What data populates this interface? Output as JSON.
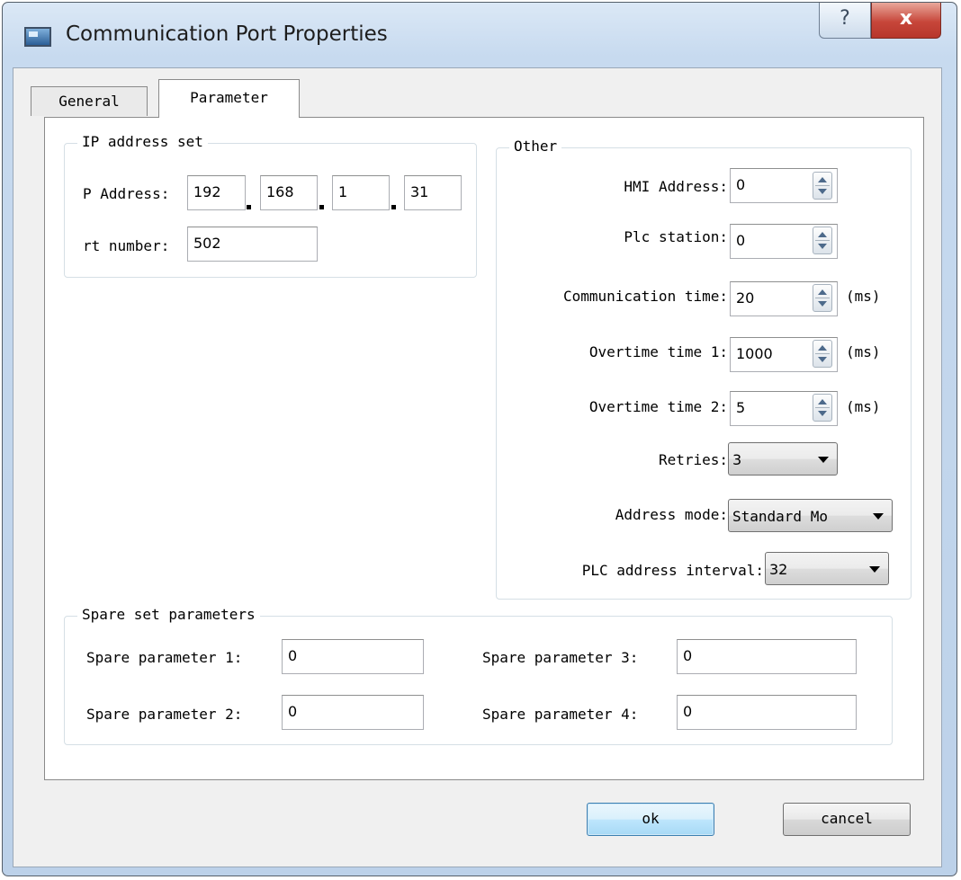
{
  "window": {
    "title": "Communication Port Properties",
    "help_label": "?",
    "close_label": "x"
  },
  "tabs": [
    {
      "label": "General",
      "active": false
    },
    {
      "label": "Parameter",
      "active": true
    }
  ],
  "ip_group": {
    "title": "IP address set",
    "ip_label": "P Address:",
    "ip_octets": [
      "192",
      "168",
      "1",
      "31"
    ],
    "port_label": "rt number:",
    "port_value": "502"
  },
  "other_group": {
    "title": "Other",
    "hmi_address": {
      "label": "HMI Address:",
      "value": "0"
    },
    "plc_station": {
      "label": "Plc station:",
      "value": "0"
    },
    "communication_time": {
      "label": "Communication time:",
      "value": "20",
      "unit": "(ms)"
    },
    "overtime_time_1": {
      "label": "Overtime time 1:",
      "value": "1000",
      "unit": "(ms)"
    },
    "overtime_time_2": {
      "label": "Overtime time 2:",
      "value": "5",
      "unit": "(ms)"
    },
    "retries": {
      "label": "Retries:",
      "value": "3"
    },
    "address_mode": {
      "label": "Address mode:",
      "value": "Standard Mo"
    },
    "plc_address_interval": {
      "label": "PLC address interval:",
      "value": "32"
    }
  },
  "spare_group": {
    "title": "Spare set parameters",
    "params": [
      {
        "label": "Spare parameter 1:",
        "value": "0"
      },
      {
        "label": "Spare parameter 2:",
        "value": "0"
      },
      {
        "label": "Spare parameter 3:",
        "value": "0"
      },
      {
        "label": "Spare parameter 4:",
        "value": "0"
      }
    ]
  },
  "buttons": {
    "ok": "ok",
    "cancel": "cancel"
  }
}
